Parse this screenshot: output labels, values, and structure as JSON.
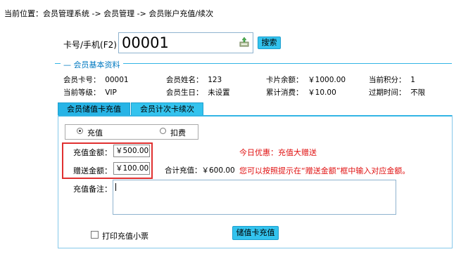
{
  "breadcrumb": "当前位置：会员管理系统 -> 会员管理 -> 会员账户充值/续次",
  "lookup": {
    "label": "卡号/手机(F2)：",
    "value": "00001",
    "search_label": "搜索"
  },
  "member_info": {
    "section_title": "会员基本资料",
    "card_no_label": "会员卡号：",
    "card_no": "00001",
    "name_label": "会员姓名：",
    "name": "123",
    "balance_label": "卡片余额：",
    "balance": "￥1000.00",
    "points_label": "当前积分：",
    "points": "1",
    "level_label": "当前等级：",
    "level": "VIP",
    "birthday_label": "会员生日：",
    "birthday": "未设置",
    "spent_label": "累计消费：",
    "spent": "￥10.00",
    "expiry_label": "过期时间：",
    "expiry": "不限"
  },
  "tabs": [
    {
      "label": "会员储值卡充值"
    },
    {
      "label": "会员计次卡续次"
    }
  ],
  "form": {
    "mode_recharge": "充值",
    "mode_deduct": "扣费",
    "recharge_amount_label": "充值金额：",
    "recharge_amount": "￥500.00",
    "bonus_amount_label": "赠送金额：",
    "bonus_amount": "￥100.00",
    "total_label": "合计充值：",
    "total": "￥600.00",
    "promo": "今日优惠：充值大赠送",
    "hint": "您可以按照提示在“赠送金额”框中输入对应金额。",
    "remark_label": "充值备注：",
    "remark": "",
    "print_receipt_label": "打印充值小票",
    "submit_label": "储值卡充值"
  },
  "colors": {
    "accent": "#33c3ee",
    "section_title": "#0079c1",
    "highlight": "#e03030",
    "hint": "#e01010"
  }
}
